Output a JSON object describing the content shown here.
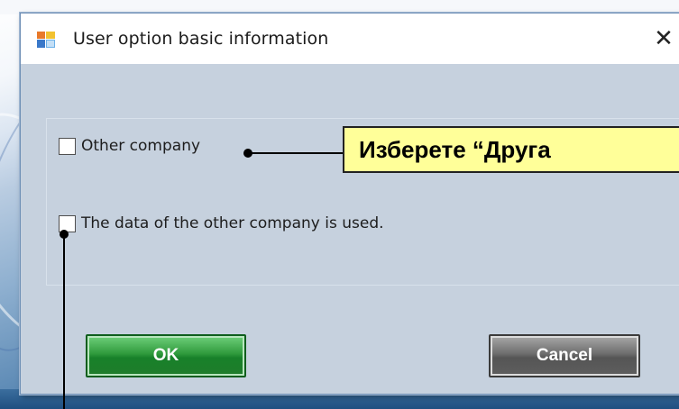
{
  "window": {
    "title": "User option basic information",
    "close_glyph": "✕",
    "icon": "app-window-icon"
  },
  "options": {
    "other_company": {
      "label": "Other company",
      "checked": false
    },
    "use_other_company_data": {
      "label": "The data of the other company is used.",
      "checked": false
    }
  },
  "buttons": {
    "ok_label": "OK",
    "cancel_label": "Cancel"
  },
  "annotation": {
    "callout_text": "Изберете “Друга"
  },
  "colors": {
    "ok_button": "#1f8a2e",
    "cancel_button": "#5e5e5e",
    "callout_background": "#ffff99",
    "dialog_body": "#c6d1de"
  }
}
